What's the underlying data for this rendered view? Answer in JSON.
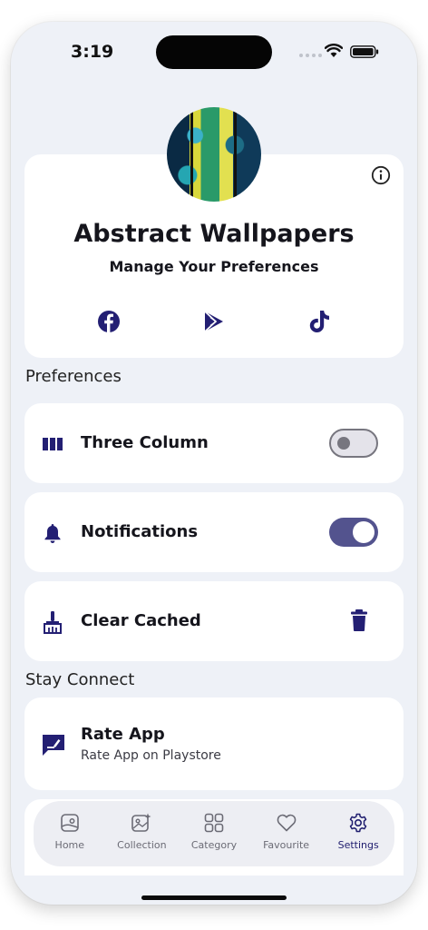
{
  "status_bar": {
    "time": "3:19"
  },
  "header": {
    "title": "Abstract Wallpapers",
    "subtitle": "Manage Your Preferences",
    "icons": [
      "info-icon",
      "facebook-icon",
      "play-store-icon",
      "tiktok-icon"
    ]
  },
  "preferences": {
    "section_title": "Preferences",
    "items": [
      {
        "label": "Three Column",
        "icon": "columns-icon",
        "control": "toggle",
        "on": false
      },
      {
        "label": "Notifications",
        "icon": "bell-icon",
        "control": "toggle",
        "on": true
      },
      {
        "label": "Clear Cached",
        "icon": "broom-icon",
        "control": "trash-icon"
      }
    ]
  },
  "stay_connect": {
    "section_title": "Stay Connect",
    "rate": {
      "label": "Rate App",
      "sublabel": "Rate App on Playstore",
      "icon": "rate-edit-icon"
    }
  },
  "bottom_nav": {
    "items": [
      {
        "label": "Home",
        "icon": "home-image-icon"
      },
      {
        "label": "Collection",
        "icon": "collection-icon"
      },
      {
        "label": "Category",
        "icon": "category-grid-icon"
      },
      {
        "label": "Favourite",
        "icon": "heart-icon"
      },
      {
        "label": "Settings",
        "icon": "gear-icon"
      }
    ],
    "active": "Settings"
  },
  "colors": {
    "accent": "#1f1d6e",
    "toggle_on": "#53538e",
    "background": "#eef1f7"
  }
}
